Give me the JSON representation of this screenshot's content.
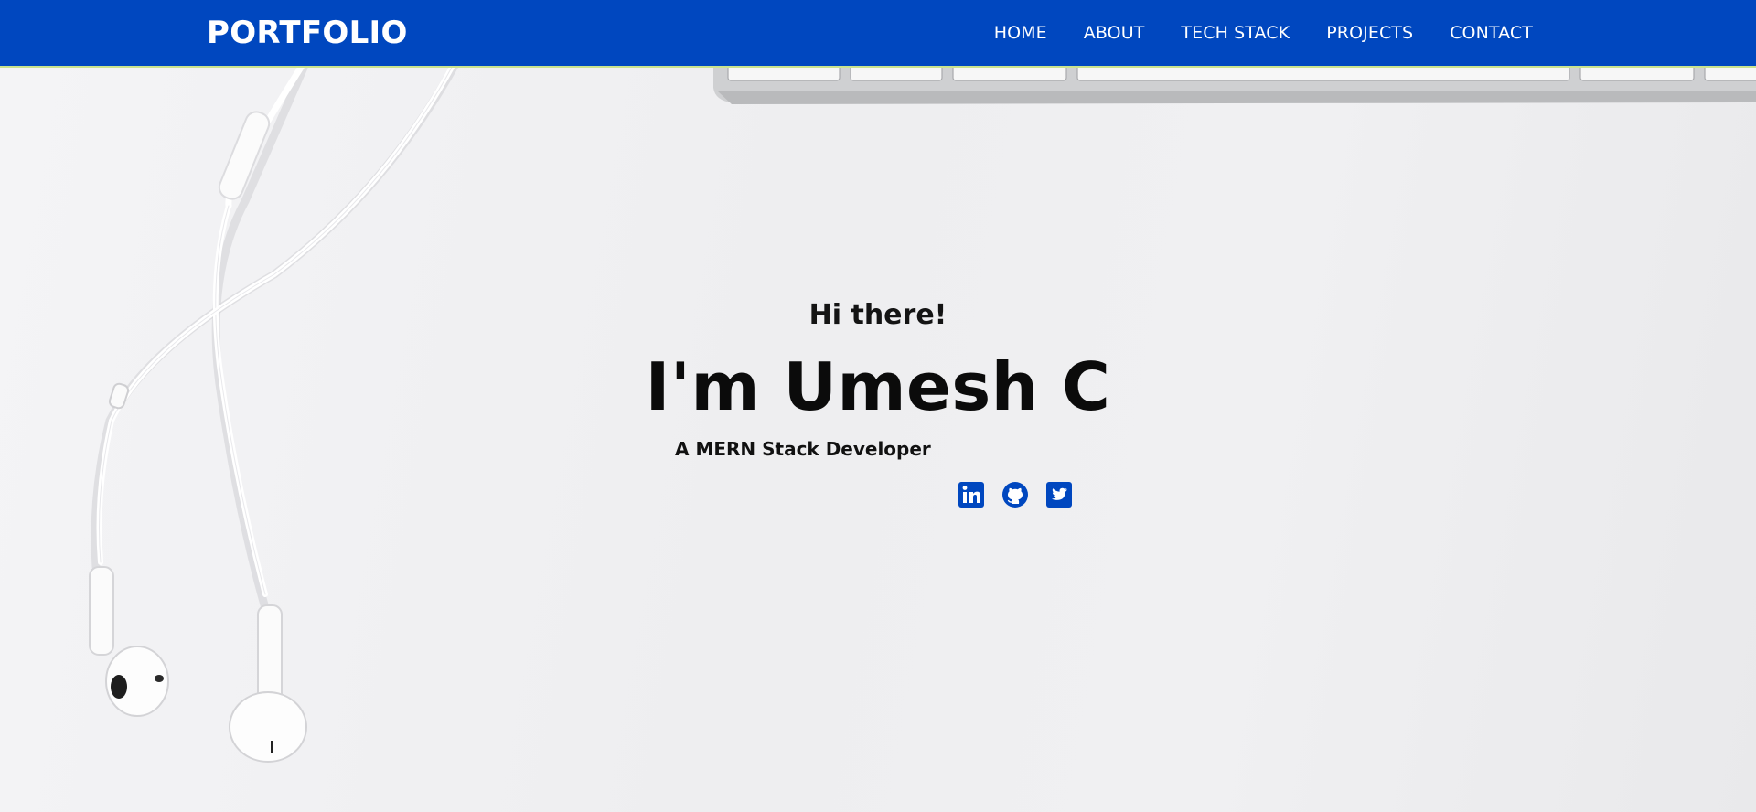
{
  "nav": {
    "brand": "PORTFOLIO",
    "links": [
      {
        "label": "HOME"
      },
      {
        "label": "ABOUT"
      },
      {
        "label": "TECH STACK"
      },
      {
        "label": "PROJECTS"
      },
      {
        "label": "CONTACT"
      }
    ]
  },
  "hero": {
    "greeting": "Hi there!",
    "name": "I'm Umesh C",
    "role": "A MERN Stack Developer"
  },
  "social": [
    {
      "icon": "linkedin-icon"
    },
    {
      "icon": "github-icon"
    },
    {
      "icon": "twitter-icon"
    }
  ],
  "colors": {
    "brand_blue": "#0047bf",
    "nav_border": "#c9e38f",
    "text_dark": "#0b0b0b",
    "background": "#efeff1"
  }
}
